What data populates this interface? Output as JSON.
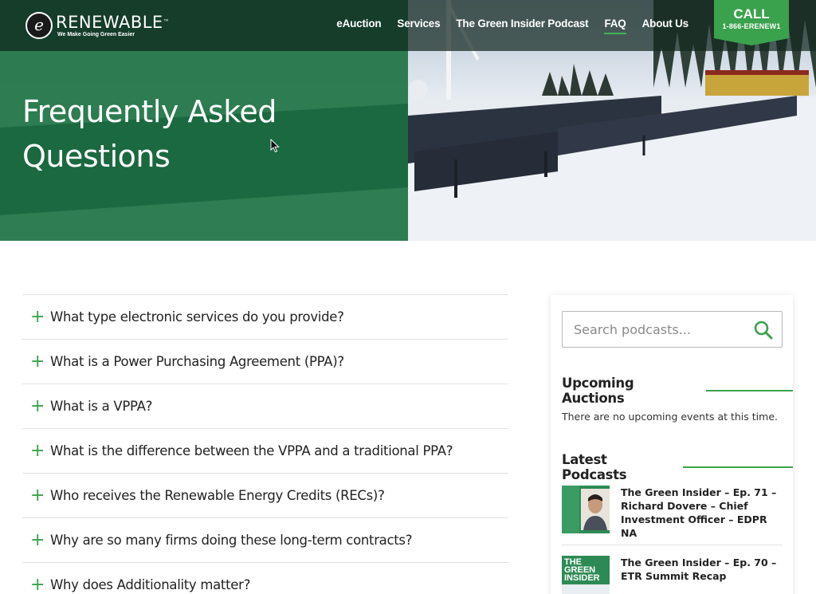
{
  "brand": {
    "logo_letter": "e",
    "name": "RENEWABLE",
    "trademark": "™",
    "tagline": "We Make Going Green Easier",
    "accent_color": "#3aa24d",
    "hero_overlay_color": "#1a7040"
  },
  "nav": {
    "items": [
      {
        "label": "eAuction",
        "active": false
      },
      {
        "label": "Services",
        "active": false
      },
      {
        "label": "The Green Insider Podcast",
        "active": false
      },
      {
        "label": "FAQ",
        "active": true
      },
      {
        "label": "About Us",
        "active": false
      }
    ]
  },
  "call": {
    "label": "CALL",
    "number": "1-866-ERENEW1"
  },
  "hero": {
    "title_line1": "Frequently Asked",
    "title_line2": "Questions"
  },
  "faq": {
    "expand_icon": "plus-icon",
    "items": [
      {
        "question": "What type electronic services do you provide?"
      },
      {
        "question": "What is a Power Purchasing Agreement (PPA)?"
      },
      {
        "question": "What is a VPPA?"
      },
      {
        "question": "What is the difference between the VPPA and a traditional PPA?"
      },
      {
        "question": "Who receives the Renewable Energy Credits (RECs)?"
      },
      {
        "question": "Why are so many firms doing these long-term contracts?"
      },
      {
        "question": "Why does Additionality matter?"
      }
    ]
  },
  "sidebar": {
    "search": {
      "placeholder": "Search podcasts...",
      "icon": "search-icon"
    },
    "auctions": {
      "title": "Upcoming Auctions",
      "empty_text": "There are no upcoming events at this time."
    },
    "podcasts": {
      "title": "Latest Podcasts",
      "items": [
        {
          "title": "The Green Insider – Ep. 71 – Richard Dovere – Chief Investment Officer – EDPR NA"
        },
        {
          "title": "The Green Insider – Ep. 70 – ETR Summit Recap",
          "thumb_text_1": "THE",
          "thumb_text_2": "GREEN",
          "thumb_text_3": "INSIDER"
        }
      ]
    }
  }
}
